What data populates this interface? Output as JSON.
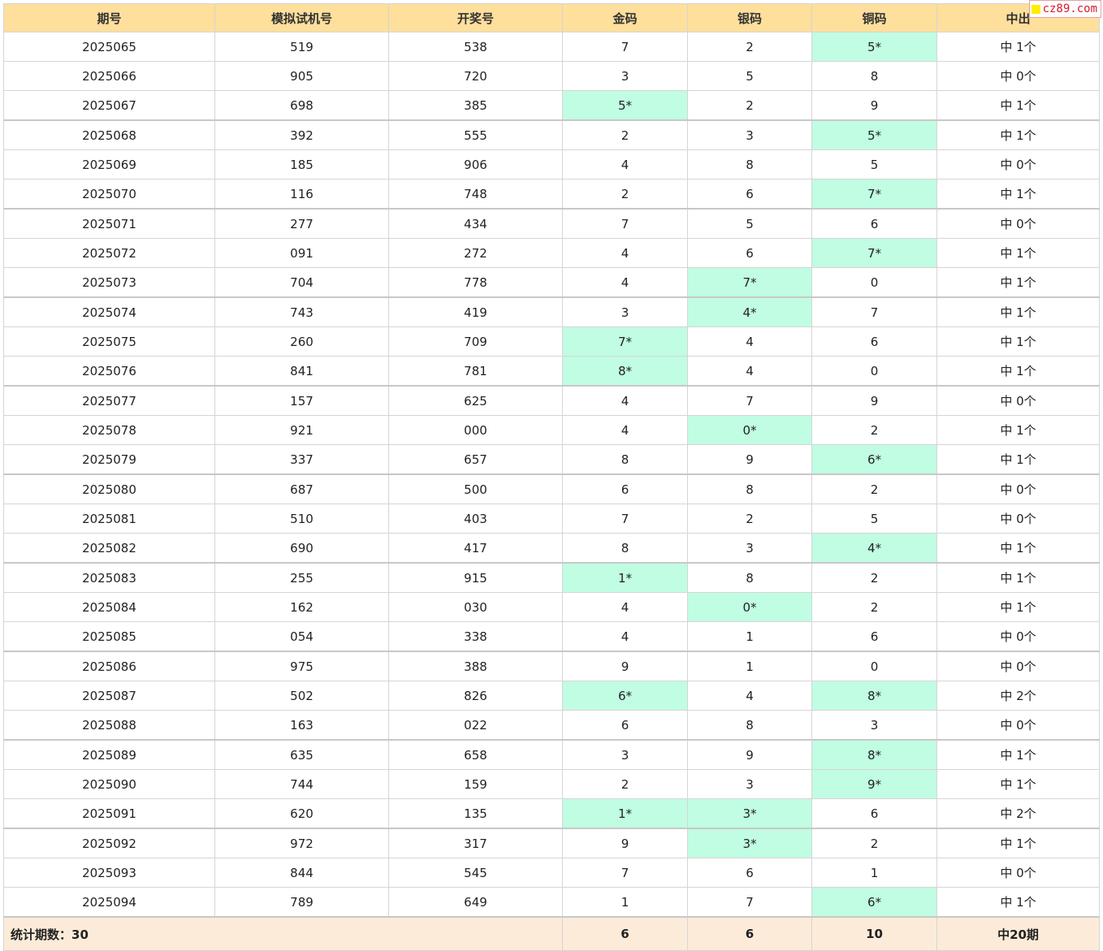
{
  "headers": [
    "期号",
    "模拟试机号",
    "开奖号",
    "金码",
    "银码",
    "铜码",
    "中出"
  ],
  "rows": [
    {
      "period": "2025065",
      "sim": "519",
      "draw": "538",
      "gold": "7",
      "silver": "2",
      "bronze": "5*",
      "result": "中 1个"
    },
    {
      "period": "2025066",
      "sim": "905",
      "draw": "720",
      "gold": "3",
      "silver": "5",
      "bronze": "8",
      "result": "中 0个"
    },
    {
      "period": "2025067",
      "sim": "698",
      "draw": "385",
      "gold": "5*",
      "silver": "2",
      "bronze": "9",
      "result": "中 1个"
    },
    {
      "period": "2025068",
      "sim": "392",
      "draw": "555",
      "gold": "2",
      "silver": "3",
      "bronze": "5*",
      "result": "中 1个"
    },
    {
      "period": "2025069",
      "sim": "185",
      "draw": "906",
      "gold": "4",
      "silver": "8",
      "bronze": "5",
      "result": "中 0个"
    },
    {
      "period": "2025070",
      "sim": "116",
      "draw": "748",
      "gold": "2",
      "silver": "6",
      "bronze": "7*",
      "result": "中 1个"
    },
    {
      "period": "2025071",
      "sim": "277",
      "draw": "434",
      "gold": "7",
      "silver": "5",
      "bronze": "6",
      "result": "中 0个"
    },
    {
      "period": "2025072",
      "sim": "091",
      "draw": "272",
      "gold": "4",
      "silver": "6",
      "bronze": "7*",
      "result": "中 1个"
    },
    {
      "period": "2025073",
      "sim": "704",
      "draw": "778",
      "gold": "4",
      "silver": "7*",
      "bronze": "0",
      "result": "中 1个"
    },
    {
      "period": "2025074",
      "sim": "743",
      "draw": "419",
      "gold": "3",
      "silver": "4*",
      "bronze": "7",
      "result": "中 1个"
    },
    {
      "period": "2025075",
      "sim": "260",
      "draw": "709",
      "gold": "7*",
      "silver": "4",
      "bronze": "6",
      "result": "中 1个"
    },
    {
      "period": "2025076",
      "sim": "841",
      "draw": "781",
      "gold": "8*",
      "silver": "4",
      "bronze": "0",
      "result": "中 1个"
    },
    {
      "period": "2025077",
      "sim": "157",
      "draw": "625",
      "gold": "4",
      "silver": "7",
      "bronze": "9",
      "result": "中 0个"
    },
    {
      "period": "2025078",
      "sim": "921",
      "draw": "000",
      "gold": "4",
      "silver": "0*",
      "bronze": "2",
      "result": "中 1个"
    },
    {
      "period": "2025079",
      "sim": "337",
      "draw": "657",
      "gold": "8",
      "silver": "9",
      "bronze": "6*",
      "result": "中 1个"
    },
    {
      "period": "2025080",
      "sim": "687",
      "draw": "500",
      "gold": "6",
      "silver": "8",
      "bronze": "2",
      "result": "中 0个"
    },
    {
      "period": "2025081",
      "sim": "510",
      "draw": "403",
      "gold": "7",
      "silver": "2",
      "bronze": "5",
      "result": "中 0个"
    },
    {
      "period": "2025082",
      "sim": "690",
      "draw": "417",
      "gold": "8",
      "silver": "3",
      "bronze": "4*",
      "result": "中 1个"
    },
    {
      "period": "2025083",
      "sim": "255",
      "draw": "915",
      "gold": "1*",
      "silver": "8",
      "bronze": "2",
      "result": "中 1个"
    },
    {
      "period": "2025084",
      "sim": "162",
      "draw": "030",
      "gold": "4",
      "silver": "0*",
      "bronze": "2",
      "result": "中 1个"
    },
    {
      "period": "2025085",
      "sim": "054",
      "draw": "338",
      "gold": "4",
      "silver": "1",
      "bronze": "6",
      "result": "中 0个"
    },
    {
      "period": "2025086",
      "sim": "975",
      "draw": "388",
      "gold": "9",
      "silver": "1",
      "bronze": "0",
      "result": "中 0个"
    },
    {
      "period": "2025087",
      "sim": "502",
      "draw": "826",
      "gold": "6*",
      "silver": "4",
      "bronze": "8*",
      "result": "中 2个"
    },
    {
      "period": "2025088",
      "sim": "163",
      "draw": "022",
      "gold": "6",
      "silver": "8",
      "bronze": "3",
      "result": "中 0个"
    },
    {
      "period": "2025089",
      "sim": "635",
      "draw": "658",
      "gold": "3",
      "silver": "9",
      "bronze": "8*",
      "result": "中 1个"
    },
    {
      "period": "2025090",
      "sim": "744",
      "draw": "159",
      "gold": "2",
      "silver": "3",
      "bronze": "9*",
      "result": "中 1个"
    },
    {
      "period": "2025091",
      "sim": "620",
      "draw": "135",
      "gold": "1*",
      "silver": "3*",
      "bronze": "6",
      "result": "中 2个"
    },
    {
      "period": "2025092",
      "sim": "972",
      "draw": "317",
      "gold": "9",
      "silver": "3*",
      "bronze": "2",
      "result": "中 1个"
    },
    {
      "period": "2025093",
      "sim": "844",
      "draw": "545",
      "gold": "7",
      "silver": "6",
      "bronze": "1",
      "result": "中 0个"
    },
    {
      "period": "2025094",
      "sim": "789",
      "draw": "649",
      "gold": "1",
      "silver": "7",
      "bronze": "6*",
      "result": "中 1个"
    }
  ],
  "footer": {
    "label": "统计期数：30",
    "gold_total": "6",
    "silver_total": "6",
    "bronze_total": "10",
    "result_total": "中20期"
  },
  "colors": {
    "header_bg": "#fedf9c",
    "hit_bg": "#c0fde3",
    "footer_bg": "#fcebd8",
    "watermark_text": "#d8192f",
    "watermark_square": "#ffee00"
  },
  "watermark": {
    "text": "cz89.com"
  }
}
